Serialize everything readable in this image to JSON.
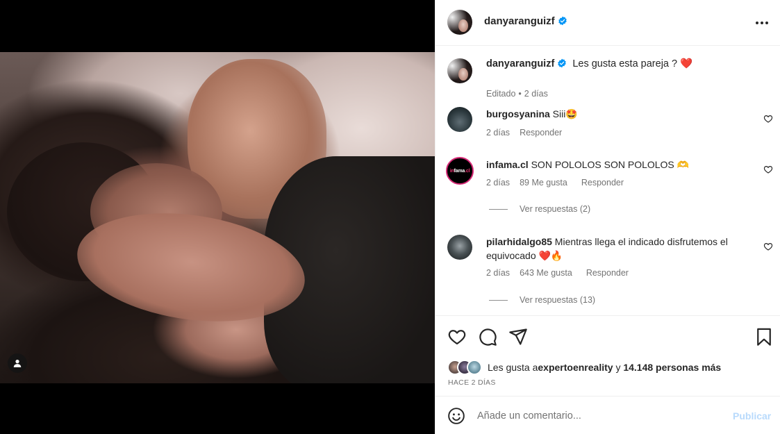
{
  "post": {
    "author": "danyaranguizf",
    "verified": true,
    "caption": "Les gusta esta pareja ? ",
    "caption_emoji": "❤️",
    "caption_meta": [
      "Editado",
      "•",
      "2 días"
    ]
  },
  "comments": [
    {
      "user": "burgosyanina",
      "text": " Siii🤩",
      "time": "2 días",
      "likes": "",
      "reply": "Responder"
    },
    {
      "user": "infama.cl",
      "text": " SON POLOLOS SON POLOLOS 🫶",
      "time": "2 días",
      "likes": "89 Me gusta",
      "reply": "Responder",
      "view_replies": "Ver respuestas (2)",
      "avatar_logo": "infama"
    },
    {
      "user": "pilarhidalgo85",
      "text": " Mientras llega el indicado disfrutemos el equivocado ❤️🔥",
      "time": "2 días",
      "likes": "643 Me gusta",
      "reply": "Responder",
      "view_replies": "Ver respuestas (13)"
    }
  ],
  "actions": {
    "icons": [
      "heart-icon",
      "comment-icon",
      "share-icon",
      "bookmark-icon"
    ]
  },
  "likes": {
    "prefix": "Les gusta a ",
    "user": "expertoenreality",
    "middle": " y ",
    "count": "14.148 personas más"
  },
  "time_ago": "HACE 2 DÍAS",
  "add_comment": {
    "placeholder": "Añade un comentario...",
    "publish": "Publicar"
  },
  "colors": {
    "verified": "#0095f6",
    "publish_disabled": "#b8dafc",
    "infama_ring": "#d62976"
  }
}
